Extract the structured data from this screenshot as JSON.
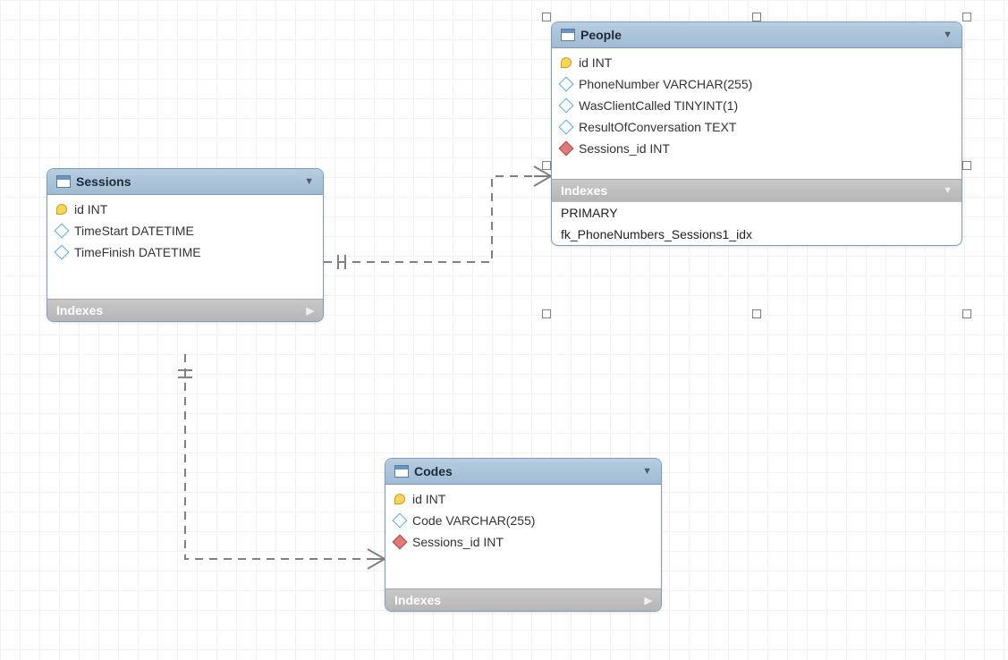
{
  "entities": {
    "sessions": {
      "title": "Sessions",
      "header_caret": "▼",
      "columns": [
        {
          "label": "id INT",
          "icon": "pk"
        },
        {
          "label": "TimeStart DATETIME",
          "icon": "attr"
        },
        {
          "label": "TimeFinish DATETIME",
          "icon": "attr"
        }
      ],
      "indexes_section": {
        "label": "Indexes",
        "caret": "▶",
        "expanded": false
      }
    },
    "people": {
      "title": "People",
      "header_caret": "▼",
      "columns": [
        {
          "label": "id INT",
          "icon": "pk"
        },
        {
          "label": "PhoneNumber VARCHAR(255)",
          "icon": "attr"
        },
        {
          "label": "WasClientCalled TINYINT(1)",
          "icon": "attr"
        },
        {
          "label": "ResultOfConversation TEXT",
          "icon": "attr"
        },
        {
          "label": "Sessions_id INT",
          "icon": "fk"
        }
      ],
      "indexes_section": {
        "label": "Indexes",
        "caret": "▼",
        "expanded": true
      },
      "indexes": [
        "PRIMARY",
        "fk_PhoneNumbers_Sessions1_idx"
      ]
    },
    "codes": {
      "title": "Codes",
      "header_caret": "▼",
      "columns": [
        {
          "label": "id INT",
          "icon": "pk"
        },
        {
          "label": "Code VARCHAR(255)",
          "icon": "attr"
        },
        {
          "label": "Sessions_id INT",
          "icon": "fk"
        }
      ],
      "indexes_section": {
        "label": "Indexes",
        "caret": "▶",
        "expanded": false
      }
    }
  },
  "relationships": [
    {
      "from": "sessions",
      "to": "people",
      "type": "one-to-many"
    },
    {
      "from": "sessions",
      "to": "codes",
      "type": "one-to-many"
    }
  ]
}
